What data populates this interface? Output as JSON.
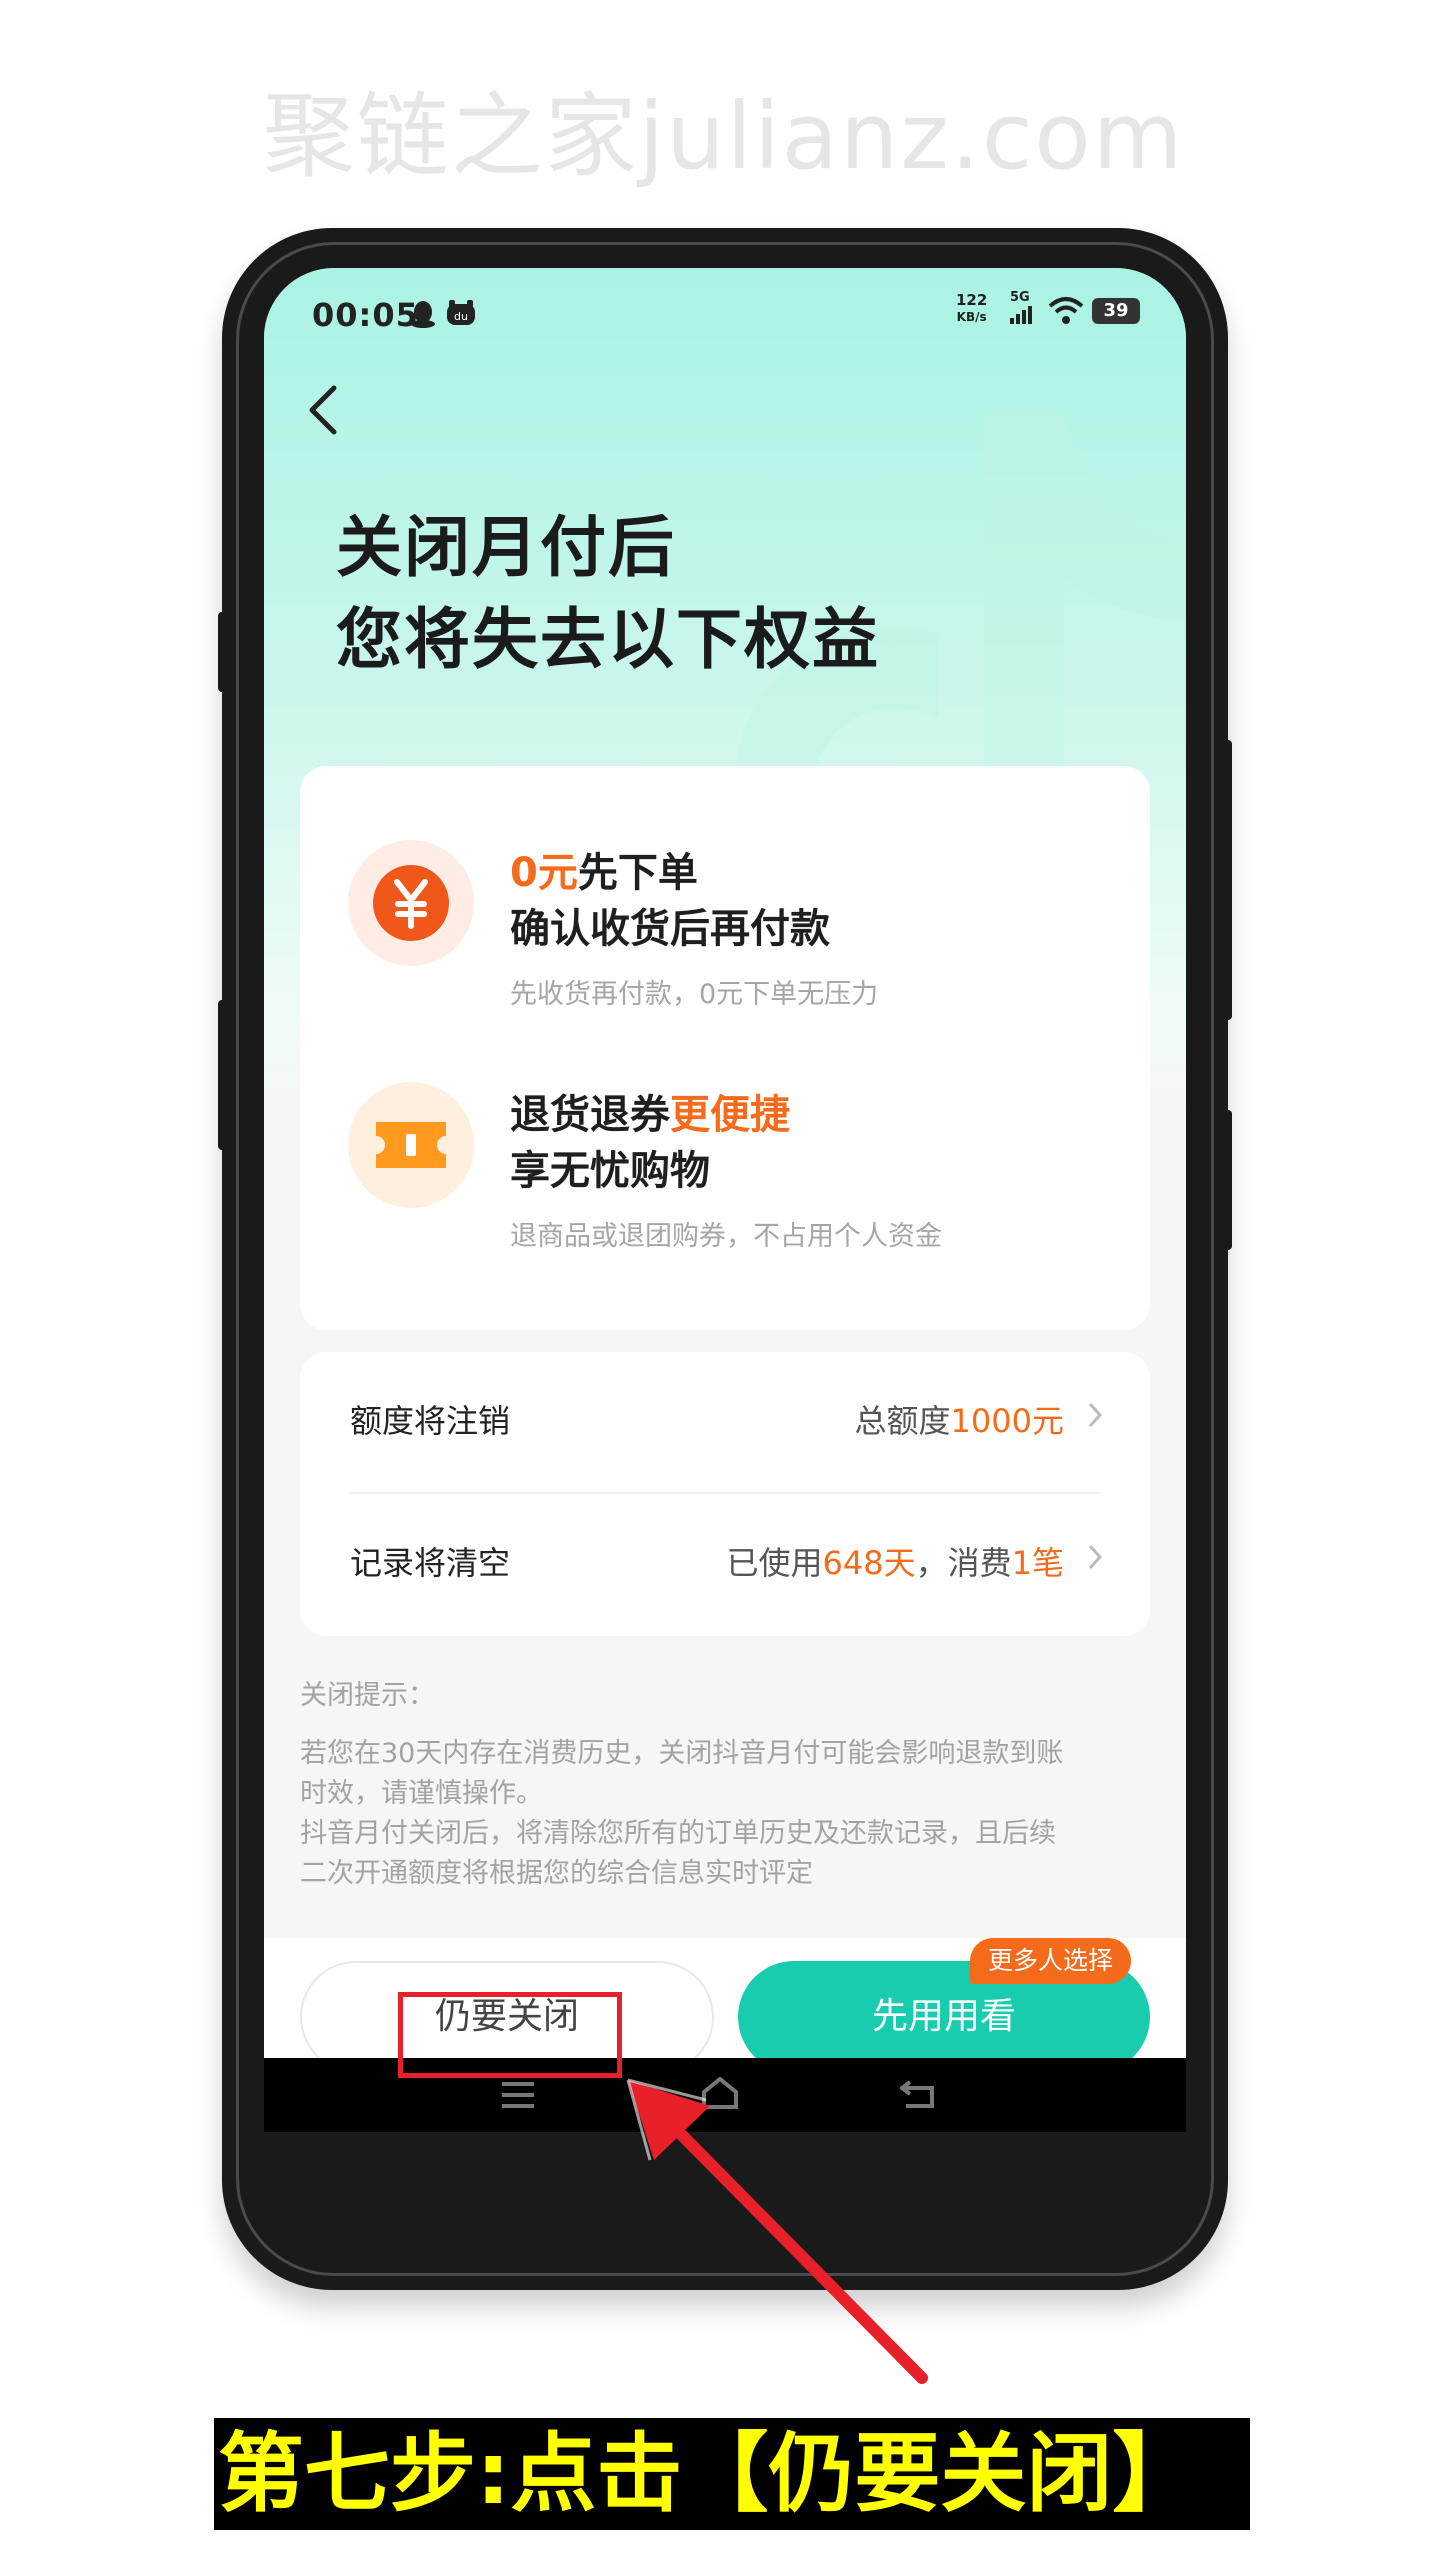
{
  "watermark": "聚链之家julianz.com",
  "status_bar": {
    "time": "00:05",
    "net_speed_value": "122",
    "net_speed_unit": "KB/s",
    "network": "5G",
    "battery": "39"
  },
  "header": {
    "title_line1": "关闭月付后",
    "title_line2": "您将失去以下权益"
  },
  "benefits": [
    {
      "icon": "yuan-icon",
      "title_highlight": "0元",
      "title_rest": "先下单",
      "title_line2": "确认收货后再付款",
      "subtitle": "先收货再付款，0元下单无压力"
    },
    {
      "icon": "ticket-icon",
      "title_plain": "退货退券",
      "title_highlight": "更便捷",
      "title_line2": "享无忧购物",
      "subtitle": "退商品或退团购券，不占用个人资金"
    }
  ],
  "info_rows": [
    {
      "label": "额度将注销",
      "value_prefix": "总额度",
      "value_highlight": "1000元"
    },
    {
      "label": "记录将清空",
      "value_prefix": "已使用",
      "value_highlight": "648天",
      "value_middle": "，消费",
      "value_highlight2": "1笔"
    }
  ],
  "notes": {
    "heading": "关闭提示：",
    "line1": "若您在30天内存在消费历史，关闭抖音月付可能会影响退款到账",
    "line2": "时效，请谨慎操作。",
    "line3": "抖音月付关闭后，将清除您所有的订单历史及还款记录，且后续",
    "line4": "二次开通额度将根据您的综合信息实时评定"
  },
  "actions": {
    "close_label": "仍要关闭",
    "use_label": "先用用看",
    "tag_label": "更多人选择"
  },
  "annotation": {
    "caption": "第七步:点击【仍要关闭】"
  },
  "colors": {
    "accent_orange": "#f56b1c",
    "primary_green": "#19ccae",
    "highlight_red": "#e8202a",
    "caption_yellow": "#ffff00"
  }
}
